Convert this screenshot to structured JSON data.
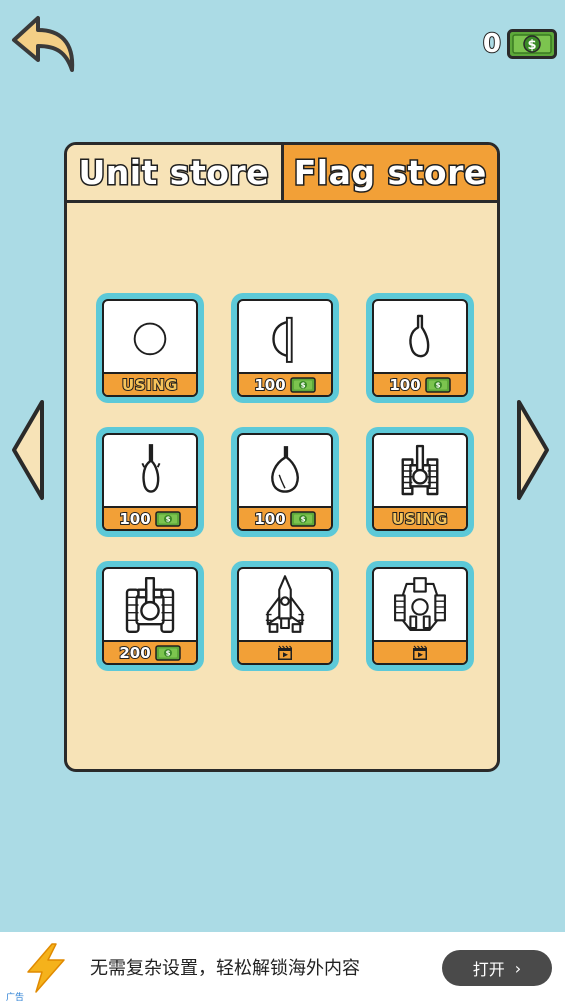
{
  "header": {
    "money": "0"
  },
  "tabs": [
    {
      "label": "Unit store"
    },
    {
      "label": "Flag store"
    }
  ],
  "items": [
    {
      "art": "circle",
      "footer": "using",
      "label": "USING"
    },
    {
      "art": "shield",
      "footer": "price",
      "price": "100"
    },
    {
      "art": "club",
      "footer": "price",
      "price": "100"
    },
    {
      "art": "dagger",
      "footer": "price",
      "price": "100"
    },
    {
      "art": "gourd",
      "footer": "price",
      "price": "100"
    },
    {
      "art": "tank-small",
      "footer": "using",
      "label": "USING"
    },
    {
      "art": "tank-large",
      "footer": "price",
      "price": "200"
    },
    {
      "art": "rocket-ship",
      "footer": "video"
    },
    {
      "art": "battle-ship",
      "footer": "video"
    }
  ],
  "ad": {
    "tag": "广告",
    "text": "无需复杂设置，轻松解锁海外内容",
    "button": "打开"
  },
  "colors": {
    "background": "#abdbe5",
    "panel": "#f7e3b7",
    "accent_orange": "#f2a037",
    "card_border": "#5dc9d8",
    "money_green": "#5da83a"
  }
}
